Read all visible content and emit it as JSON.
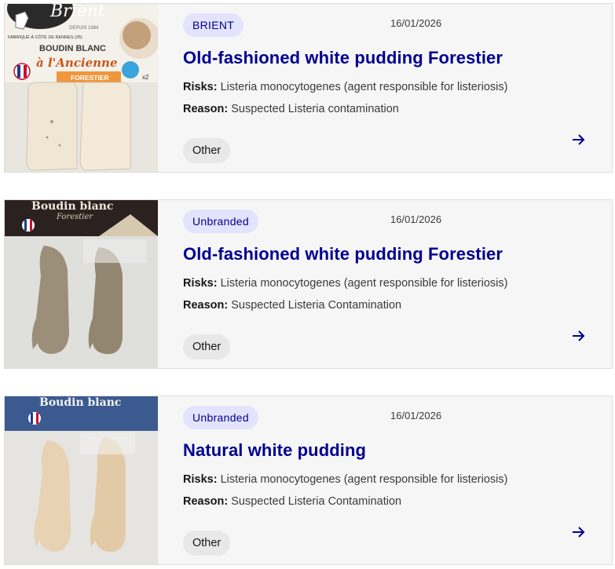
{
  "recalls": [
    {
      "brand": "BRIENT",
      "date": "16/01/2026",
      "title": "Old-fashioned white pudding Forestier",
      "risks_label": "Risks:",
      "risks": "Listeria monocytogenes (agent responsible for listeriosis)",
      "reason_label": "Reason:",
      "reason": "Suspected Listeria contamination",
      "category": "Other",
      "image": {
        "brand_text": "Brient",
        "tagline": "DEPUIS 1984",
        "line1": "BOUDIN BLANC",
        "line2": "à l'Ancienne",
        "variant": "FORESTIER",
        "origin": "FABRIQUÉ À CÔTÉ DE RENNES (35)",
        "count": "x2"
      }
    },
    {
      "brand": "Unbranded",
      "date": "16/01/2026",
      "title": "Old-fashioned white pudding Forestier",
      "risks_label": "Risks:",
      "risks": "Listeria monocytogenes (agent responsible for listeriosis)",
      "reason_label": "Reason:",
      "reason": "Suspected Listeria Contamination",
      "category": "Other",
      "image": {
        "line1": "Boudin blanc",
        "variant": "Forestier"
      }
    },
    {
      "brand": "Unbranded",
      "date": "16/01/2026",
      "title": "Natural white pudding",
      "risks_label": "Risks:",
      "risks": "Listeria monocytogenes (agent responsible for listeriosis)",
      "reason_label": "Reason:",
      "reason": "Suspected Listeria Contamination",
      "category": "Other",
      "image": {
        "line1": "Boudin blanc"
      }
    }
  ],
  "icons": {
    "arrow": "arrow-right-icon"
  },
  "colors": {
    "accent": "#000091",
    "badge_bg": "#e3e3fd",
    "card_bg": "#f6f6f6",
    "tag_bg": "#e8e8e8"
  }
}
